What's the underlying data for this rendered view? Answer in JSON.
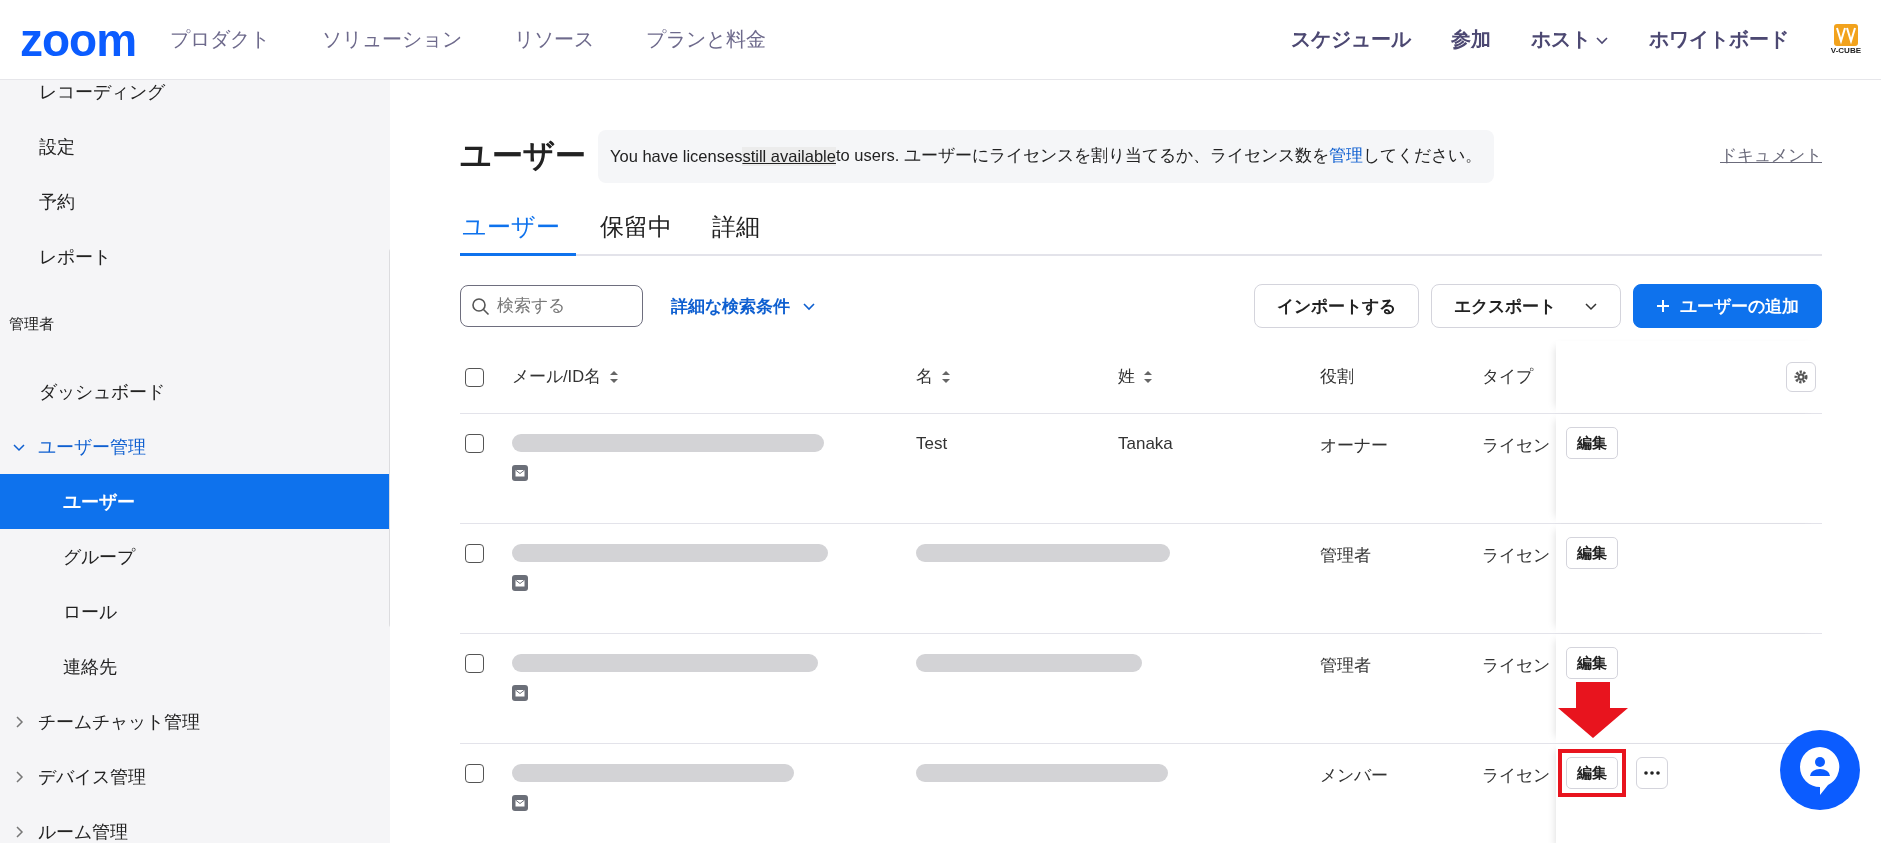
{
  "header": {
    "logo": "zoom",
    "nav": [
      "プロダクト",
      "ソリューション",
      "リソース",
      "プランと料金"
    ],
    "right_nav": [
      {
        "label": "スケジュール",
        "kind": "link"
      },
      {
        "label": "参加",
        "kind": "link"
      },
      {
        "label": "ホスト",
        "kind": "dropdown"
      },
      {
        "label": "ホワイトボード",
        "kind": "link"
      }
    ],
    "brand_badge": "V-CUBE"
  },
  "sidebar": {
    "items": [
      {
        "kind": "item",
        "label": "レコーディング",
        "selected": false
      },
      {
        "kind": "item",
        "label": "設定",
        "selected": false
      },
      {
        "kind": "item",
        "label": "予約",
        "selected": false
      },
      {
        "kind": "item",
        "label": "レポート",
        "selected": false
      },
      {
        "kind": "section",
        "label": "管理者"
      },
      {
        "kind": "item",
        "label": "ダッシュボード",
        "selected": false
      },
      {
        "kind": "group",
        "label": "ユーザー管理",
        "expanded": true,
        "children": [
          {
            "label": "ユーザー",
            "selected": true
          },
          {
            "label": "グループ",
            "selected": false
          },
          {
            "label": "ロール",
            "selected": false
          },
          {
            "label": "連絡先",
            "selected": false
          }
        ]
      },
      {
        "kind": "group",
        "label": "チームチャット管理",
        "expanded": false
      },
      {
        "kind": "group",
        "label": "デバイス管理",
        "expanded": false
      },
      {
        "kind": "group",
        "label": "ルーム管理",
        "expanded": false
      }
    ]
  },
  "page": {
    "title": "ユーザー",
    "notice": [
      {
        "kind": "plain",
        "text": "You have licenses "
      },
      {
        "kind": "underline",
        "text": "still available"
      },
      {
        "kind": "plain",
        "text": " to users. ユーザーにライセンスを割り当てるか、ライセンス数を"
      },
      {
        "kind": "link",
        "text": "管理"
      },
      {
        "kind": "plain",
        "text": "してください。"
      }
    ],
    "doc_link": "ドキュメント",
    "tabs": [
      {
        "label": "ユーザー",
        "selected": true
      },
      {
        "label": "保留中",
        "selected": false
      },
      {
        "label": "詳細",
        "selected": false
      }
    ],
    "search": {
      "placeholder": "検索する"
    },
    "filter_link": "詳細な検索条件",
    "buttons": [
      {
        "label": "インポートする",
        "kind": "outline"
      },
      {
        "label": "エクスポート",
        "kind": "dropdown"
      },
      {
        "label": "ユーザーの追加",
        "kind": "primary"
      }
    ]
  },
  "table": {
    "all_checked": false,
    "columns": [
      {
        "label": "メール/ID名",
        "sortable": true
      },
      {
        "label": "名",
        "sortable": true
      },
      {
        "label": "姓",
        "sortable": true
      },
      {
        "label": "役割",
        "sortable": false
      },
      {
        "label": "タイプ",
        "sortable": false
      }
    ],
    "rows": [
      {
        "checked": false,
        "names_redacted": false,
        "first_name": "Test",
        "last_name": "Tanaka",
        "role": "オーナー",
        "type": "ライセン",
        "action": "編集",
        "more": false,
        "highlighted": false
      },
      {
        "checked": false,
        "names_redacted": true,
        "role": "管理者",
        "type": "ライセン",
        "action": "編集",
        "more": false,
        "highlighted": false
      },
      {
        "checked": false,
        "names_redacted": true,
        "role": "管理者",
        "type": "ライセン",
        "action": "編集",
        "more": false,
        "highlighted": false
      },
      {
        "checked": false,
        "names_redacted": true,
        "role": "メンバー",
        "type": "ライセン",
        "action": "編集",
        "more": true,
        "highlighted": true
      }
    ]
  }
}
